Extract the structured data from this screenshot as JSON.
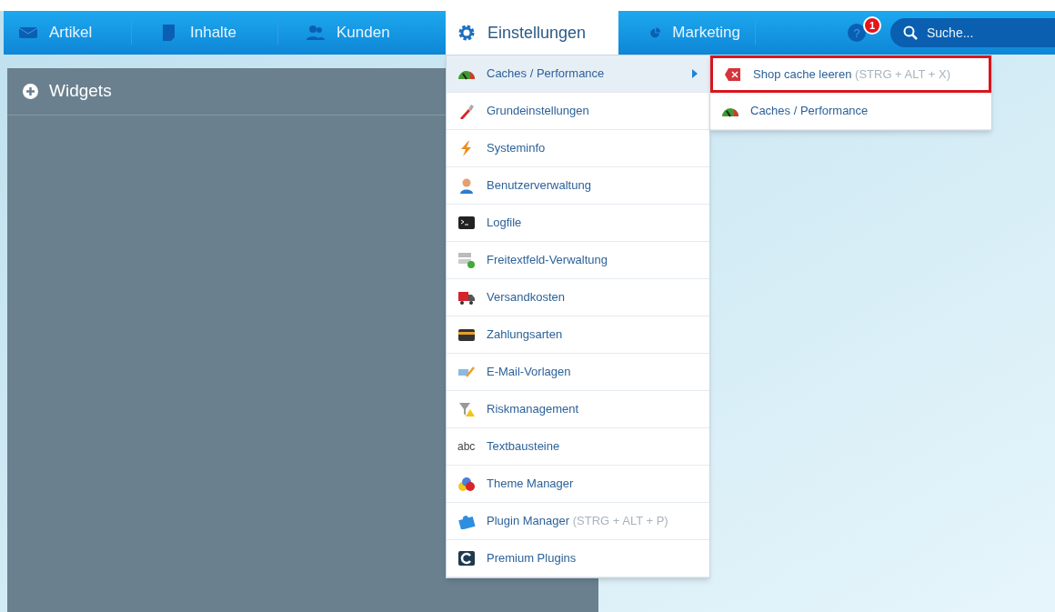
{
  "nav": [
    {
      "label": "Artikel",
      "selected": false
    },
    {
      "label": "Inhalte",
      "selected": false
    },
    {
      "label": "Kunden",
      "selected": false
    },
    {
      "label": "Einstellungen",
      "selected": true
    },
    {
      "label": "Marketing",
      "selected": false
    }
  ],
  "notifications": {
    "help_icon": "?",
    "badge": "1"
  },
  "search": {
    "placeholder": "Suche..."
  },
  "widgets_panel": {
    "title": "Widgets"
  },
  "settings_menu": [
    {
      "label": "Caches / Performance",
      "selected": true,
      "has_submenu": true
    },
    {
      "label": "Grundeinstellungen",
      "selected": false,
      "has_submenu": false
    },
    {
      "label": "Systeminfo",
      "selected": false,
      "has_submenu": false
    },
    {
      "label": "Benutzerverwaltung",
      "selected": false,
      "has_submenu": false
    },
    {
      "label": "Logfile",
      "selected": false,
      "has_submenu": false
    },
    {
      "label": "Freitextfeld-Verwaltung",
      "selected": false,
      "has_submenu": false
    },
    {
      "label": "Versandkosten",
      "selected": false,
      "has_submenu": false
    },
    {
      "label": "Zahlungsarten",
      "selected": false,
      "has_submenu": false
    },
    {
      "label": "E-Mail-Vorlagen",
      "selected": false,
      "has_submenu": false
    },
    {
      "label": "Riskmanagement",
      "selected": false,
      "has_submenu": false
    },
    {
      "label": "Textbausteine",
      "selected": false,
      "has_submenu": false,
      "icon_text": "abc"
    },
    {
      "label": "Theme Manager",
      "selected": false,
      "has_submenu": false
    },
    {
      "label": "Plugin Manager",
      "shortcut": "(STRG + ALT + P)",
      "selected": false,
      "has_submenu": false
    },
    {
      "label": "Premium Plugins",
      "selected": false,
      "has_submenu": false
    }
  ],
  "submenu": [
    {
      "label": "Shop cache leeren",
      "shortcut": "(STRG + ALT + X)",
      "selected": true
    },
    {
      "label": "Caches / Performance",
      "selected": false
    }
  ]
}
